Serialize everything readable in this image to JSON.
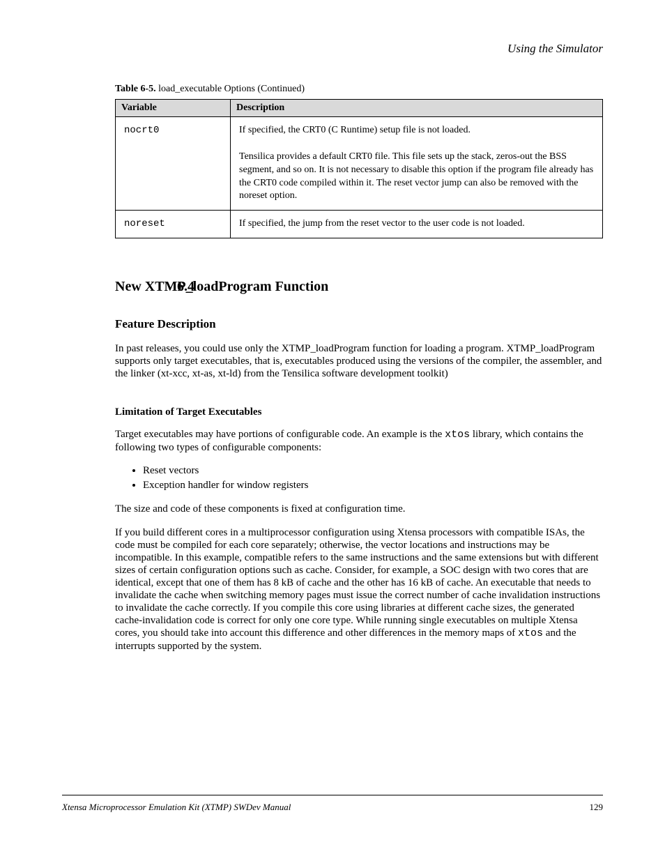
{
  "header": {
    "running": "Using the Simulator",
    "section_number": "6.4"
  },
  "table": {
    "caption_prefix": "Table 6-5.",
    "caption": "load_executable Options (Continued)",
    "columns": [
      "Variable",
      "Description"
    ],
    "rows": [
      {
        "variable": "nocrt0",
        "description_lines": [
          "If specified, the CRT0 (C Runtime) setup file is not loaded.",
          "Tensilica provides a default CRT0 file. This file sets up the stack, zeros-out the BSS segment, and so on. It is not necessary to disable this option if the program file already has the CRT0 code compiled within it. The reset vector jump can also be removed with the noreset option."
        ]
      },
      {
        "variable": "noreset",
        "description": "If specified, the jump from the reset vector to the user code is not loaded."
      }
    ]
  },
  "section": {
    "h1": "New XTMP_loadProgram Function",
    "h2": "Feature Description",
    "p1": "In past releases, you could use only the XTMP_loadProgram function for loading a program. XTMP_loadProgram supports only target executables, that is, executables produced using the versions of the compiler, the assembler, and the linker (xt-xcc, xt-as, xt-ld) from the Tensilica software development toolkit)",
    "h3": "Limitation of Target Executables",
    "p2_before_mono": "Target executables may have portions of configurable code. An example is the ",
    "p2_mono": "xtos",
    "p2_after_mono": " library, which contains the following two types of configurable components:",
    "bullets": [
      "Reset vectors",
      "Exception handler for window registers"
    ],
    "p3": "The size and code of these components is fixed at configuration time.",
    "p4_before_mono": "If you build different cores in a multiprocessor configuration using Xtensa processors with compatible ISAs, the code must be compiled for each core separately; otherwise, the vector locations and instructions may be incompatible. In this example, compatible refers to the same instructions and the same extensions but with different sizes of certain configuration options such as cache. Consider, for example, a SOC design with two cores that are identical, except that one of them has 8 kB of cache and the other has 16 kB of cache. An executable that needs to invalidate the cache when switching memory pages must issue the correct number of cache invalidation instructions to invalidate the cache correctly. If you compile this core using libraries at different cache sizes, the generated cache-invalidation code is correct for only one core type. While running single executables on multiple Xtensa cores, you should take into account this difference and other differences in the memory maps of ",
    "p4_mono": "xtos",
    "p4_after_mono": " and the interrupts supported by the system."
  },
  "footer": {
    "left": "Xtensa Microprocessor Emulation Kit (XTMP) SWDev Manual",
    "right": "129"
  }
}
